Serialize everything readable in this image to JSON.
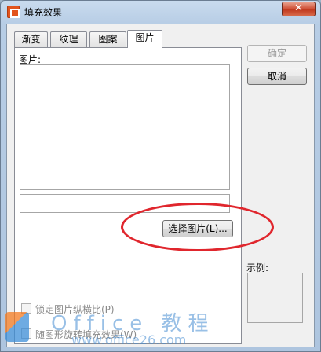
{
  "window": {
    "title": "填充效果",
    "close_label": "✕"
  },
  "tabs": [
    {
      "label": "渐变",
      "active": false
    },
    {
      "label": "纹理",
      "active": false
    },
    {
      "label": "图案",
      "active": false
    },
    {
      "label": "图片",
      "active": true
    }
  ],
  "picture_panel": {
    "label": "图片:",
    "path_value": "",
    "select_button": "选择图片(L)...",
    "lock_aspect": {
      "label": "锁定图片纵横比(P)",
      "checked": false,
      "enabled": false
    },
    "rotate_with_shape": {
      "label": "随图形旋转填充效果(W)",
      "checked": false,
      "enabled": false
    }
  },
  "actions": {
    "ok_label": "确定",
    "cancel_label": "取消"
  },
  "sample": {
    "label": "示例:"
  },
  "watermark": {
    "title": "Office 教程",
    "url": "www.office26.com",
    "logo_icon": "office-logo-icon"
  },
  "colors": {
    "highlight_ring": "#e0262d",
    "app_icon": "#e2541c"
  }
}
